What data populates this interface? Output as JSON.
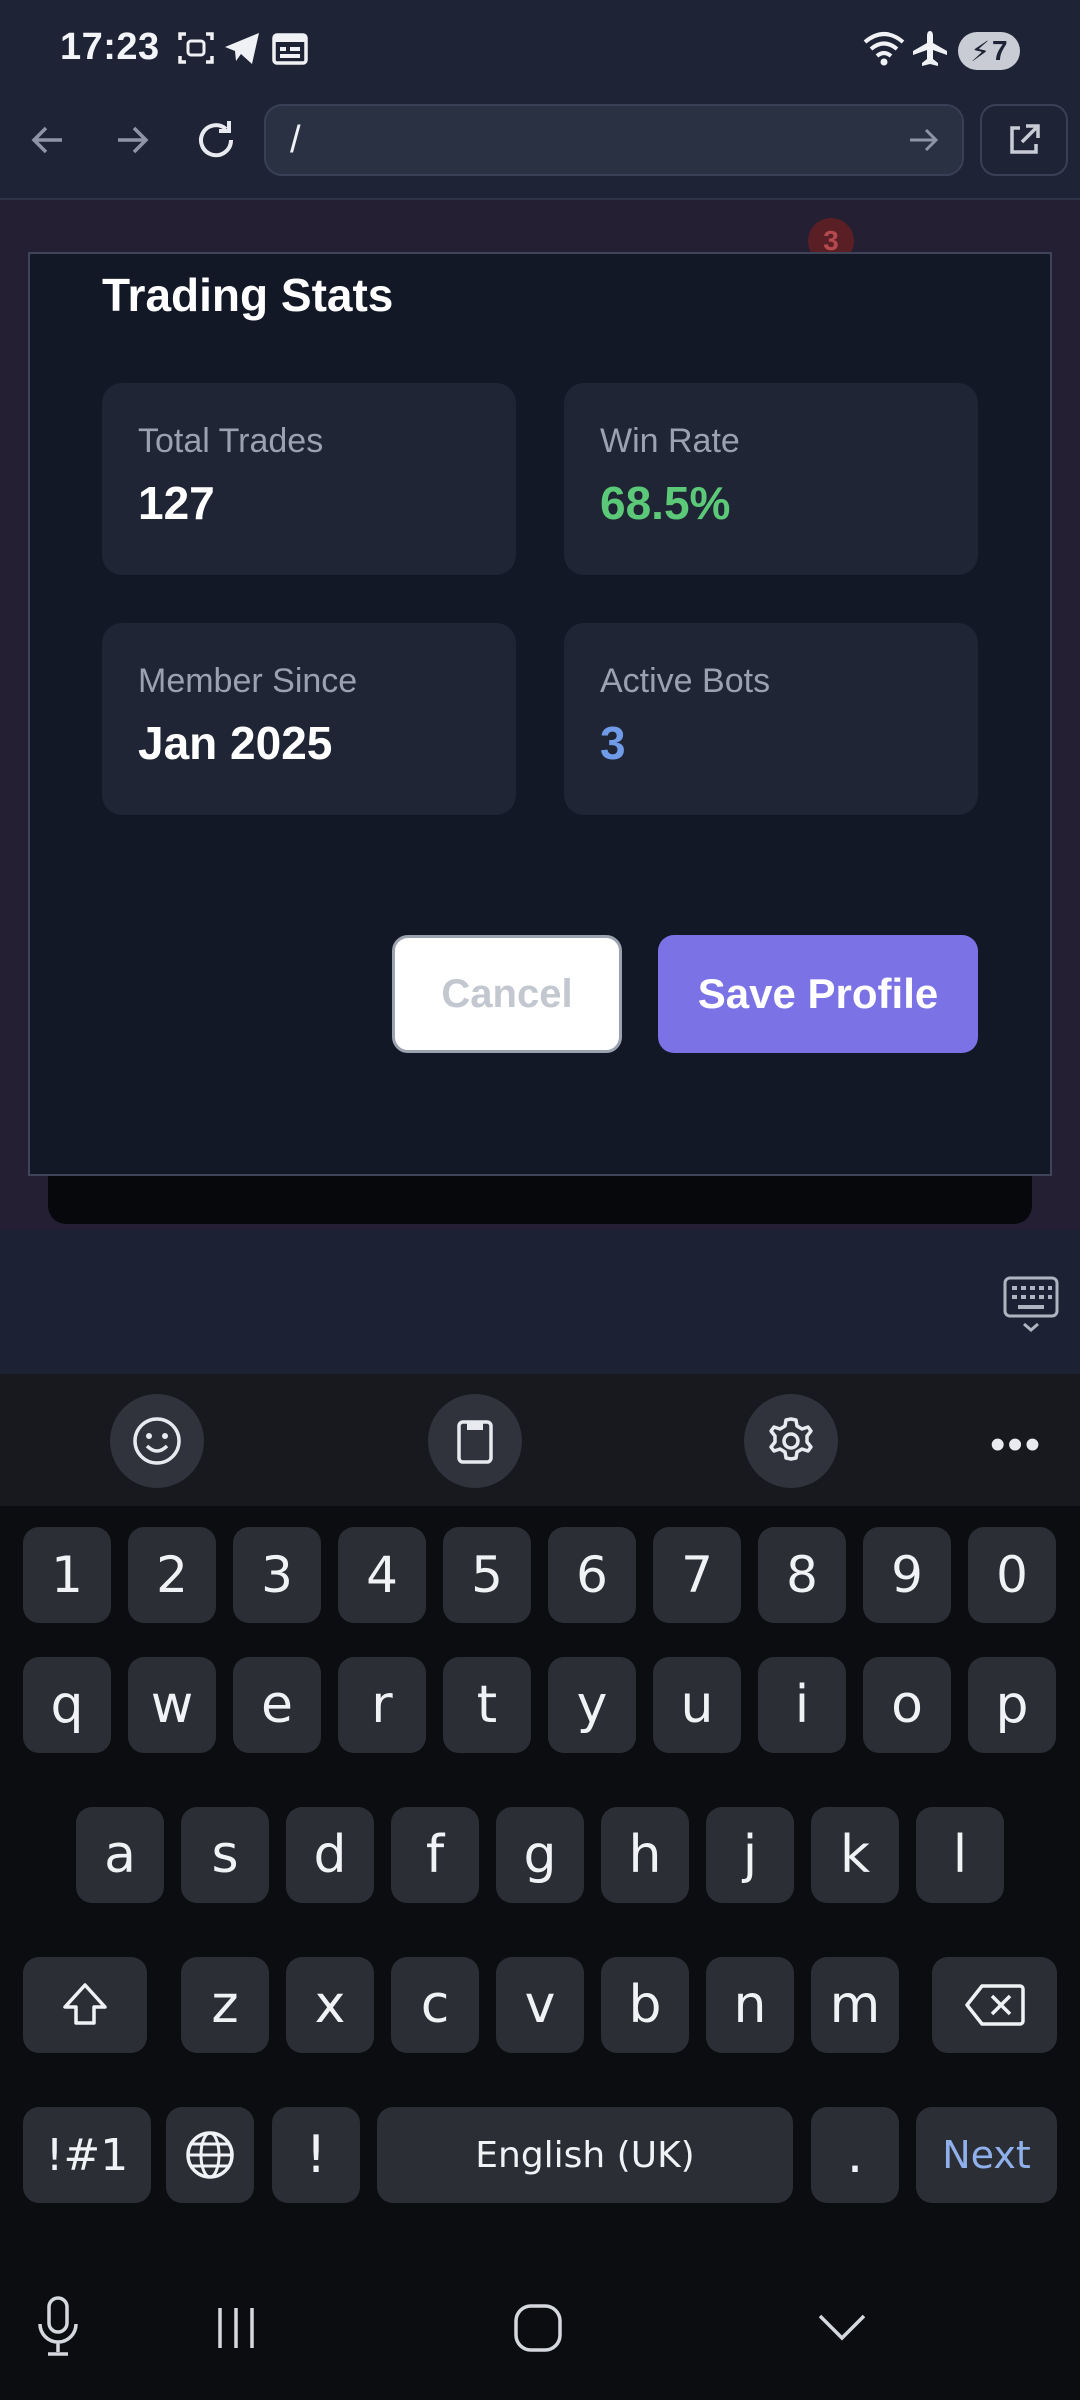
{
  "status_bar": {
    "time": "17:23",
    "battery": "7",
    "icons": [
      "screenshot-icon",
      "telegram-icon",
      "calendar-icon",
      "wifi-icon",
      "airplane-icon",
      "battery-charging-icon"
    ]
  },
  "browser": {
    "url": "/",
    "icons": [
      "back-arrow-icon",
      "forward-arrow-icon",
      "reload-icon",
      "go-arrow-icon",
      "open-external-icon"
    ]
  },
  "background_page": {
    "badge_count": "3"
  },
  "modal": {
    "title": "Trading Stats",
    "stats": [
      {
        "label": "Total Trades",
        "value": "127",
        "color": "#ffffff"
      },
      {
        "label": "Win Rate",
        "value": "68.5%",
        "color": "#5cc978"
      },
      {
        "label": "Member Since",
        "value": "Jan 2025",
        "color": "#ffffff"
      },
      {
        "label": "Active Bots",
        "value": "3",
        "color": "#6f9be8"
      }
    ],
    "cancel_label": "Cancel",
    "save_label": "Save Profile",
    "accent_color": "#7b72e6"
  },
  "keyboard": {
    "toolbar_icons": [
      "emoji-icon",
      "clipboard-icon",
      "settings-icon",
      "more-icon"
    ],
    "more_label": "•••",
    "row_numbers": [
      "1",
      "2",
      "3",
      "4",
      "5",
      "6",
      "7",
      "8",
      "9",
      "0"
    ],
    "row1": [
      "q",
      "w",
      "e",
      "r",
      "t",
      "y",
      "u",
      "i",
      "o",
      "p"
    ],
    "row2": [
      "a",
      "s",
      "d",
      "f",
      "g",
      "h",
      "j",
      "k",
      "l"
    ],
    "row3": [
      "z",
      "x",
      "c",
      "v",
      "b",
      "n",
      "m"
    ],
    "symbols_label": "!#1",
    "exclaim_label": "!",
    "space_label": "English (UK)",
    "period_label": ".",
    "next_label": "Next"
  }
}
